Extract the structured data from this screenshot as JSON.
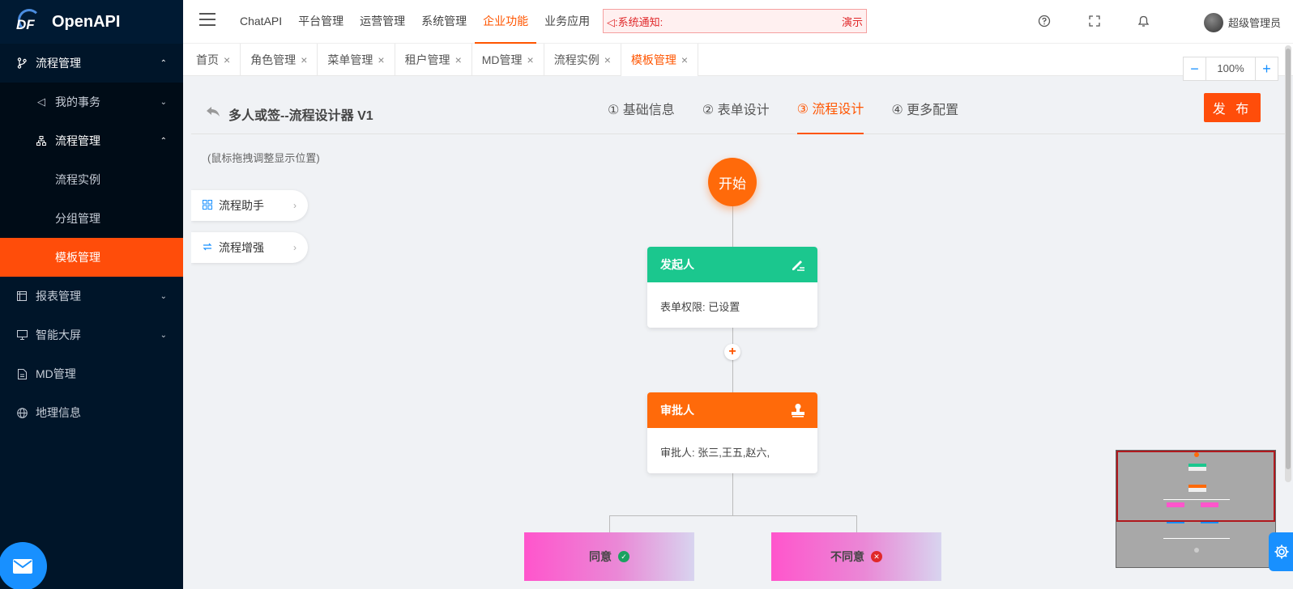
{
  "app": {
    "name": "OpenAPI",
    "logo_text": "DF"
  },
  "sidebar": {
    "items": [
      {
        "label": "流程管理",
        "icon": "branch-icon",
        "level": 1,
        "state": "open",
        "arrow": "⌃"
      },
      {
        "label": "我的事务",
        "icon": "sound-icon",
        "level": 2,
        "state": "closed",
        "arrow": "⌄"
      },
      {
        "label": "流程管理",
        "icon": "sitemap-icon",
        "level": 2,
        "state": "open",
        "arrow": "⌃"
      },
      {
        "label": "流程实例",
        "level": 3
      },
      {
        "label": "分组管理",
        "level": 3
      },
      {
        "label": "模板管理",
        "level": 3,
        "state": "active"
      },
      {
        "label": "报表管理",
        "icon": "report-icon",
        "level": 1,
        "state": "closed",
        "arrow": "⌄"
      },
      {
        "label": "智能大屏",
        "icon": "monitor-icon",
        "level": 1,
        "state": "closed",
        "arrow": "⌄"
      },
      {
        "label": "MD管理",
        "icon": "file-icon",
        "level": 1
      },
      {
        "label": "地理信息",
        "icon": "globe-icon",
        "level": 1
      }
    ]
  },
  "header": {
    "nav": [
      "ChatAPI",
      "平台管理",
      "运营管理",
      "系统管理",
      "企业功能",
      "业务应用"
    ],
    "active_nav": "企业功能",
    "notice_label": "◁:系统通知:",
    "notice_right": "演示",
    "username": "超级管理员"
  },
  "tabs": [
    {
      "label": "首页"
    },
    {
      "label": "角色管理"
    },
    {
      "label": "菜单管理"
    },
    {
      "label": "租户管理"
    },
    {
      "label": "MD管理"
    },
    {
      "label": "流程实例"
    },
    {
      "label": "模板管理",
      "active": true
    }
  ],
  "zoom": {
    "value": "100%",
    "minus": "−",
    "plus": "+"
  },
  "designer": {
    "title": "多人或签--流程设计器 V1",
    "steps": [
      "① 基础信息",
      "② 表单设计",
      "③ 流程设计",
      "④ 更多配置"
    ],
    "active_step": 2,
    "publish_label": "发 布",
    "hint": "(鼠标拖拽调整显示位置)",
    "panels": [
      "流程助手",
      "流程增强"
    ]
  },
  "flow": {
    "start_label": "开始",
    "initiator": {
      "title": "发起人",
      "body": "表单权限: 已设置",
      "color": "#1bc78e"
    },
    "approver": {
      "title": "审批人",
      "body": "审批人: 张三,王五,赵六,",
      "color": "#ff6a0a"
    },
    "conditions": [
      {
        "label": "同意",
        "badge": "✓",
        "badge_color": "#1aa260"
      },
      {
        "label": "不同意",
        "badge": "✕",
        "badge_color": "#e0282a"
      }
    ],
    "add_label": "+"
  }
}
